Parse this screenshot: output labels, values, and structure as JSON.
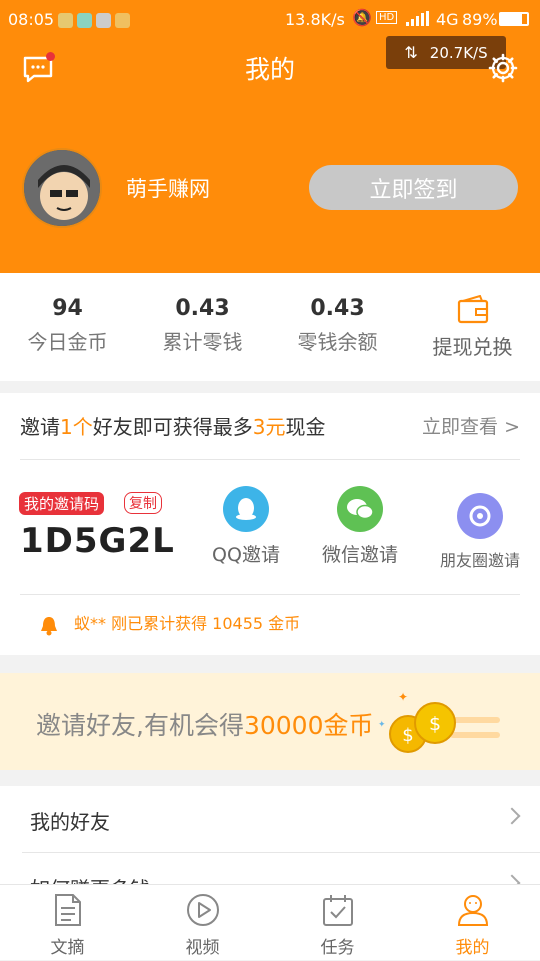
{
  "status_bar": {
    "time": "08:05",
    "net_speed": "13.8K/s",
    "hd": "HD",
    "network": "4G",
    "battery": "89%"
  },
  "speed_pill": {
    "value": "20.7K/S"
  },
  "header": {
    "title": "我的",
    "nickname": "萌手赚网",
    "signin_label": "立即签到",
    "brand_color": "#ff8c0a"
  },
  "stats": [
    {
      "value": "94",
      "label": "今日金币"
    },
    {
      "value": "0.43",
      "label": "累计零钱"
    },
    {
      "value": "0.43",
      "label": "零钱余额"
    },
    {
      "label": "提现兑换"
    }
  ],
  "invite": {
    "headline_a": "邀请",
    "headline_b": "1个",
    "headline_c": "好友即可获得最多",
    "headline_d": "3元",
    "headline_e": "现金",
    "view_now": "立即查看 >",
    "code_label": "我的邀请码",
    "copy_label": "复制",
    "code": "1D5G2L",
    "qq_label": "QQ邀请",
    "wechat_label": "微信邀请",
    "moments_label": "朋友圈邀请",
    "notice": "蚁** 刚已累计获得 10455 金币"
  },
  "banner": {
    "text_a": "邀请好友,有机会得",
    "text_b": "30000金币"
  },
  "list": [
    {
      "label": "我的好友"
    },
    {
      "label": "如何赚更多钱"
    }
  ],
  "tabs": [
    {
      "label": "文摘",
      "icon": "document-icon"
    },
    {
      "label": "视频",
      "icon": "play-icon"
    },
    {
      "label": "任务",
      "icon": "calendar-check-icon"
    },
    {
      "label": "我的",
      "icon": "person-icon",
      "active": true
    }
  ]
}
